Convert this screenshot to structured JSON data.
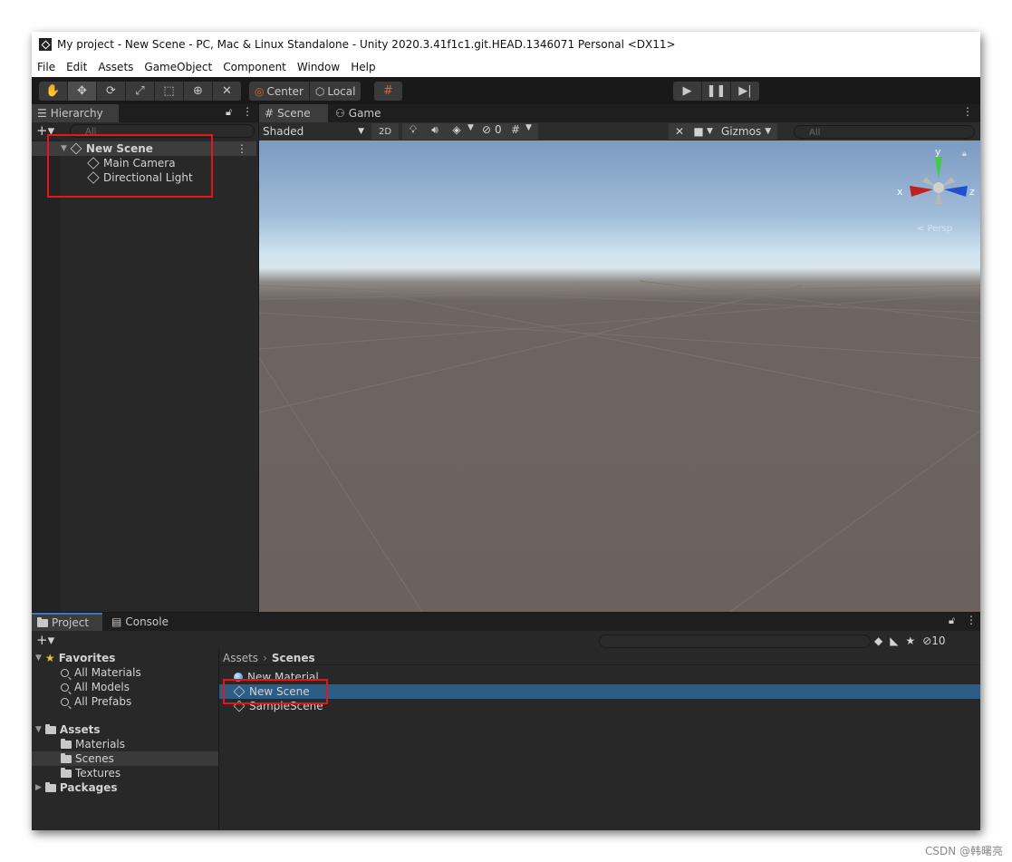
{
  "window": {
    "title": "My project - New Scene - PC, Mac & Linux Standalone - Unity 2020.3.41f1c1.git.HEAD.1346071 Personal <DX11>"
  },
  "menu": [
    "File",
    "Edit",
    "Assets",
    "GameObject",
    "Component",
    "Window",
    "Help"
  ],
  "toolbar": {
    "tools": [
      "hand-icon",
      "move-icon",
      "rotate-icon",
      "scale-icon",
      "rect-icon",
      "transform-icon",
      "custom-tool-icon"
    ],
    "pivot_mode": "Center",
    "pivot_rotation": "Local"
  },
  "hierarchy": {
    "tab": "Hierarchy",
    "search_placeholder": "All",
    "scene_name": "New Scene",
    "items": [
      "Main Camera",
      "Directional Light"
    ]
  },
  "scene_view": {
    "tabs": [
      "Scene",
      "Game"
    ],
    "shading": "Shaded",
    "mode_2d": "2D",
    "hidden_count": "0",
    "gizmos": "Gizmos",
    "search_placeholder": "All",
    "axis_x": "x",
    "axis_y": "y",
    "axis_z": "z",
    "persp": "Persp"
  },
  "project": {
    "tabs": [
      "Project",
      "Console"
    ],
    "hidden_count": "10",
    "favorites_label": "Favorites",
    "favorites": [
      "All Materials",
      "All Models",
      "All Prefabs"
    ],
    "assets_label": "Assets",
    "asset_folders": [
      "Materials",
      "Scenes",
      "Textures"
    ],
    "packages_label": "Packages",
    "breadcrumb_root": "Assets",
    "breadcrumb_current": "Scenes",
    "files": [
      "New Material",
      "New Scene",
      "SampleScene"
    ]
  },
  "watermark": "CSDN @韩曙亮",
  "colors": {
    "highlight_box": "#e8141a",
    "selection": "#2c5d87"
  }
}
